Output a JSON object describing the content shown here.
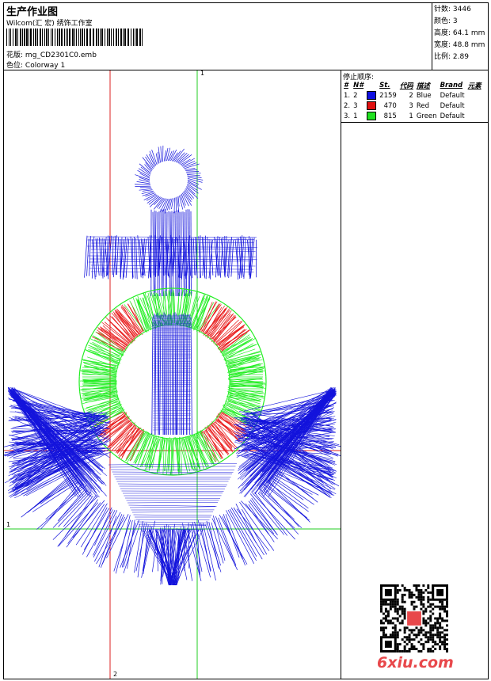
{
  "header": {
    "title": "生产作业图",
    "company": "Wilcom(汇 宏) 绣饰工作室",
    "design_label": "花版:",
    "design_file": "mg_CD2301C0.emb",
    "colorway_label": "色位:",
    "colorway": "Colorway 1"
  },
  "stats": {
    "stitches_label": "针数:",
    "stitches": "3446",
    "colors_label": "颜色:",
    "colors": "3",
    "height_label": "高度:",
    "height": "64.1 mm",
    "width_label": "宽度:",
    "width": "48.8 mm",
    "scale_label": "比例:",
    "scale": "2.89"
  },
  "sequence": {
    "title": "停止顺序:",
    "headers": [
      "#",
      "N#",
      "St.",
      "代码",
      "描述",
      "Brand",
      "元素"
    ],
    "rows": [
      {
        "idx": "1.",
        "n": "2",
        "color": "#1010e0",
        "st": "2159",
        "code": "2",
        "desc": "Blue",
        "brand": "Default"
      },
      {
        "idx": "2.",
        "n": "3",
        "color": "#e01010",
        "st": "470",
        "code": "3",
        "desc": "Red",
        "brand": "Default"
      },
      {
        "idx": "3.",
        "n": "1",
        "color": "#20e020",
        "st": "815",
        "code": "1",
        "desc": "Green",
        "brand": "Default"
      }
    ]
  },
  "axes": {
    "top_label": "1",
    "left_label": "1",
    "bottom_label": "2"
  },
  "colors": {
    "blue": "#1414dc",
    "red": "#e81414",
    "green": "#22ee22",
    "guide_red": "#dd2020",
    "guide_green": "#22cc22"
  },
  "watermark": "6xiu.com"
}
